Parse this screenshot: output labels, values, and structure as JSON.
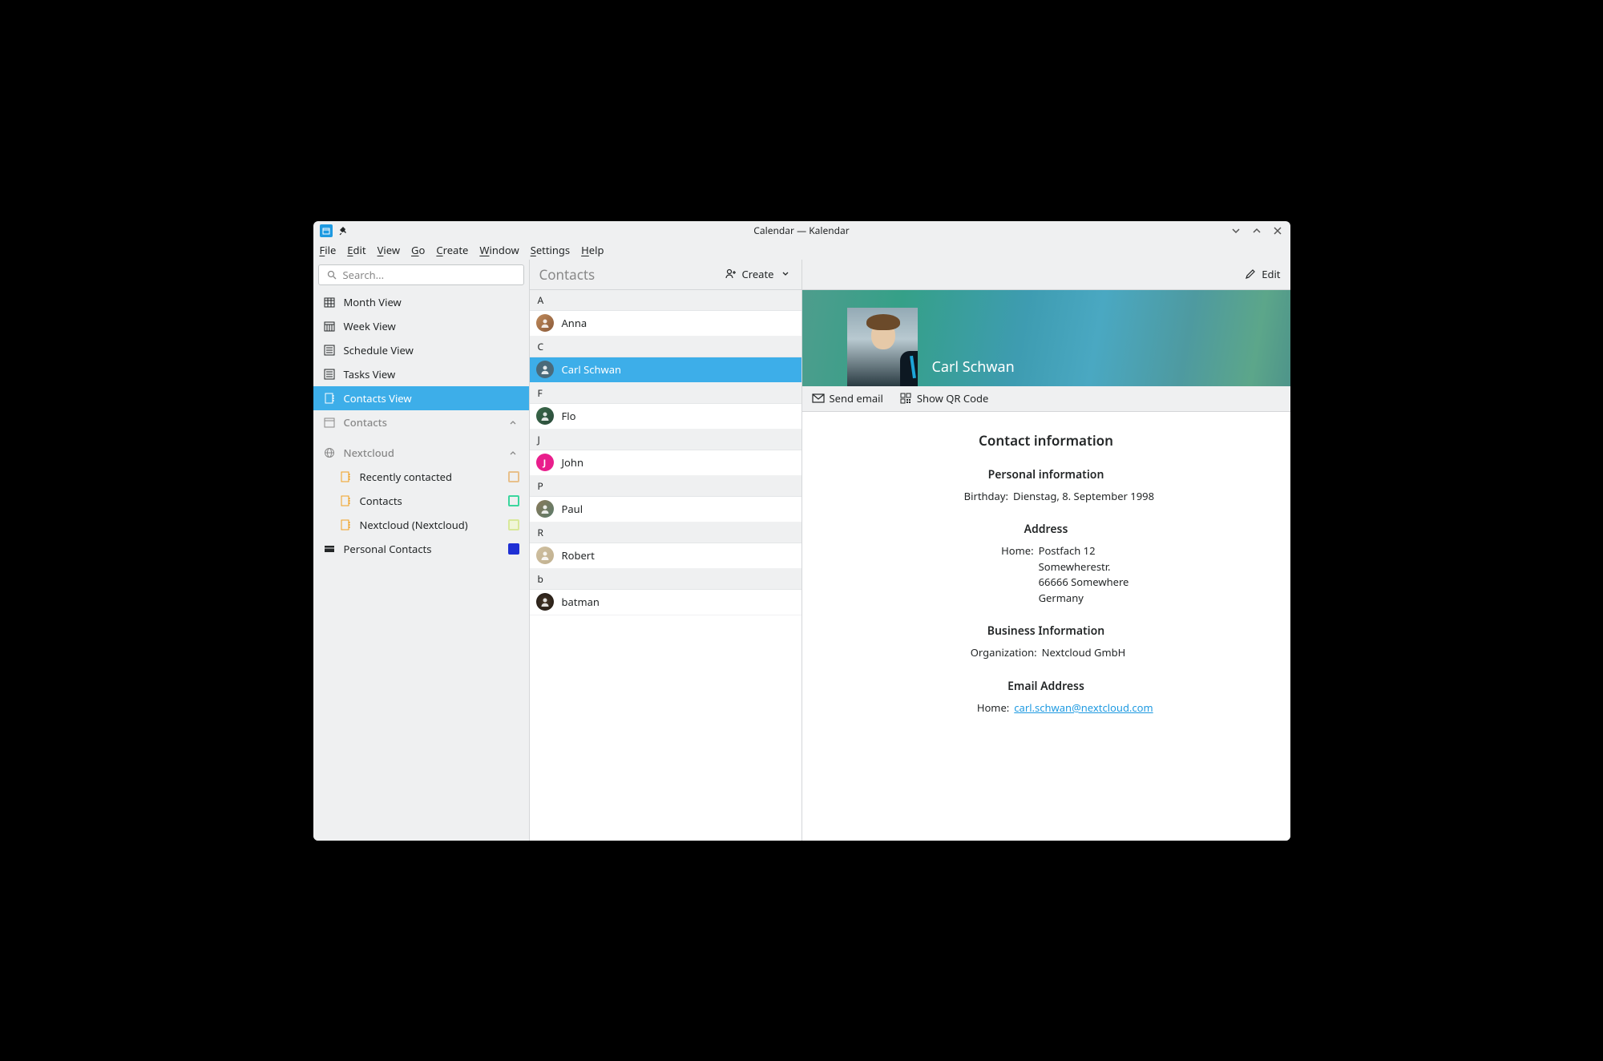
{
  "window": {
    "title": "Calendar — Kalendar"
  },
  "menubar": [
    "File",
    "Edit",
    "View",
    "Go",
    "Create",
    "Window",
    "Settings",
    "Help"
  ],
  "search": {
    "placeholder": "Search..."
  },
  "sidebar": {
    "views": [
      {
        "label": "Month View",
        "icon": "calendar-month-icon"
      },
      {
        "label": "Week View",
        "icon": "calendar-week-icon"
      },
      {
        "label": "Schedule View",
        "icon": "list-icon"
      },
      {
        "label": "Tasks View",
        "icon": "list-icon"
      },
      {
        "label": "Contacts View",
        "icon": "contacts-icon",
        "active": true
      }
    ],
    "contacts_section": "Contacts",
    "nextcloud_section": "Nextcloud",
    "nextcloud_items": [
      {
        "label": "Recently contacted",
        "color": "#e8c08b"
      },
      {
        "label": "Contacts",
        "color": "#3bd69e"
      },
      {
        "label": "Nextcloud (Nextcloud)",
        "color": "#d8e89a"
      }
    ],
    "personal_contacts": {
      "label": "Personal Contacts",
      "color": "#1e2fd4",
      "checked": true
    }
  },
  "middle": {
    "title": "Contacts",
    "create_label": "Create",
    "sections": [
      {
        "letter": "A",
        "contacts": [
          {
            "name": "Anna",
            "avatar_color": "linear-gradient(135deg,#c08a5a,#8a5a3a)"
          }
        ]
      },
      {
        "letter": "C",
        "contacts": [
          {
            "name": "Carl Schwan",
            "avatar_color": "#4a6a7a",
            "selected": true
          }
        ]
      },
      {
        "letter": "F",
        "contacts": [
          {
            "name": "Flo",
            "avatar_color": "linear-gradient(135deg,#3a6a4a,#2a4a3a)"
          }
        ]
      },
      {
        "letter": "J",
        "contacts": [
          {
            "name": "John",
            "avatar_color": "#e91e8c",
            "initial": true
          }
        ]
      },
      {
        "letter": "P",
        "contacts": [
          {
            "name": "Paul",
            "avatar_color": "linear-gradient(135deg,#8a7a5a,#5a7a6a)"
          }
        ]
      },
      {
        "letter": "R",
        "contacts": [
          {
            "name": "Robert",
            "avatar_color": "linear-gradient(135deg,#d0c0a0,#c0b090)"
          }
        ]
      },
      {
        "letter": "b",
        "contacts": [
          {
            "name": "batman",
            "avatar_color": "radial-gradient(circle,#4a3a2a,#1a1410)"
          }
        ]
      }
    ]
  },
  "detail": {
    "edit_label": "Edit",
    "name": "Carl Schwan",
    "actions": {
      "send_email": "Send email",
      "show_qr": "Show QR Code"
    },
    "contact_info_heading": "Contact information",
    "personal_info_heading": "Personal information",
    "birthday_label": "Birthday:",
    "birthday_value": "Dienstag, 8. September 1998",
    "address_heading": "Address",
    "address_label": "Home:",
    "address_lines": [
      "Postfach 12",
      "Somewherestr.",
      "66666 Somewhere",
      "Germany"
    ],
    "business_heading": "Business Information",
    "organization_label": "Organization:",
    "organization_value": "Nextcloud GmbH",
    "email_heading": "Email Address",
    "email_label": "Home:",
    "email_value": "carl.schwan@nextcloud.com"
  }
}
